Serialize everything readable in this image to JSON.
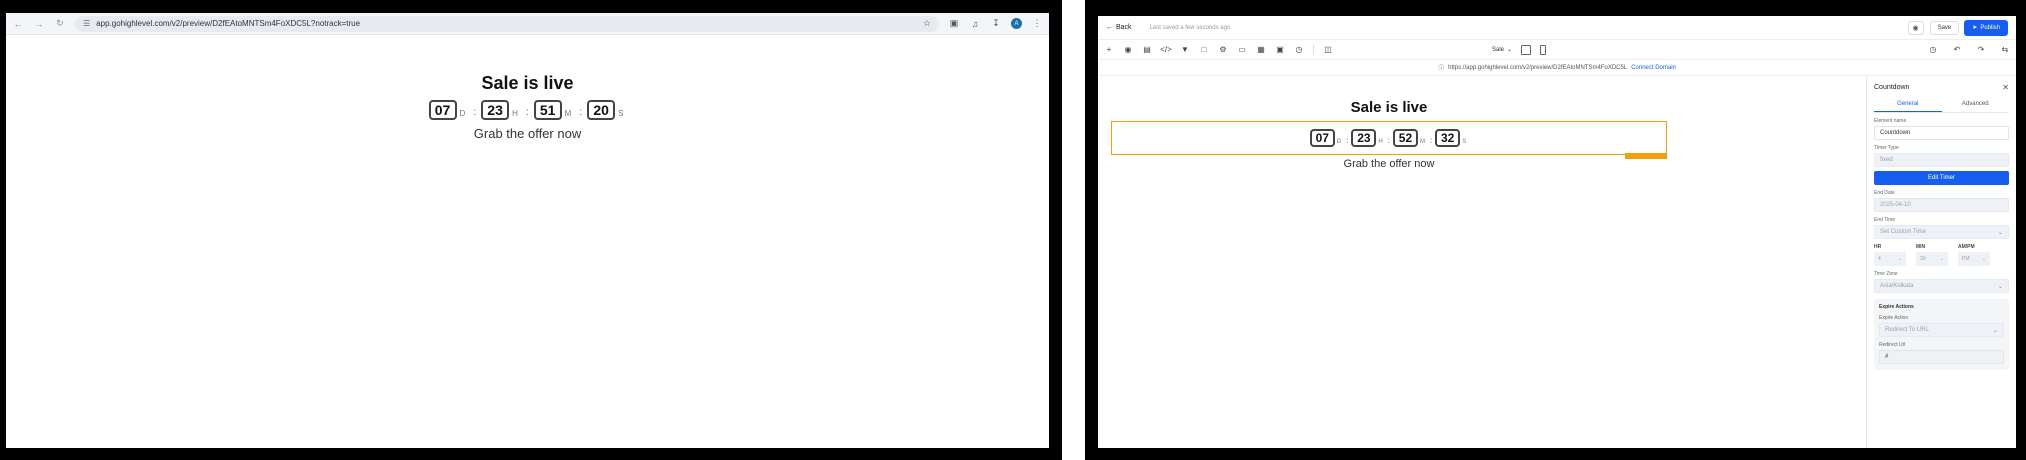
{
  "preview_browser": {
    "url": "app.gohighlevel.com/v2/preview/D2fEAtoMNTSm4FoXDC5L?notrack=true",
    "icons": [
      "back-arrow-icon",
      "forward-arrow-icon",
      "reload-icon",
      "site-settings-icon",
      "bookmark-star-icon",
      "extensions-icon",
      "media-controls-icon",
      "download-icon",
      "profile-avatar-icon",
      "more-menu-icon"
    ],
    "profile_initial": "A",
    "page": {
      "title": "Sale is live",
      "timer": {
        "days": "07",
        "days_unit": "D",
        "hours": "23",
        "hours_unit": "H",
        "minutes": "51",
        "minutes_unit": "M",
        "seconds": "20",
        "seconds_unit": "S",
        "separator": ":"
      },
      "subtitle": "Grab the offer now"
    }
  },
  "builder": {
    "header": {
      "back_label": "Back",
      "saved_text": "Last saved a few seconds ago",
      "save_label": "Save",
      "publish_label": "Publish"
    },
    "toolbar": {
      "page_select": "Sale"
    },
    "url_bar": {
      "url": "https://app.gohighlevel.com/v2/preview/D2fEAtoMNTSm4FoXDC5L",
      "connect_label": "Connect Domain"
    },
    "canvas": {
      "title": "Sale is live",
      "timer": {
        "days": "07",
        "days_unit": "D",
        "hours": "23",
        "hours_unit": "H",
        "minutes": "52",
        "minutes_unit": "M",
        "seconds": "32",
        "seconds_unit": "S",
        "separator": ":"
      },
      "subtitle": "Grab the offer now"
    },
    "side_panel": {
      "title": "Countdown",
      "tabs": [
        "General",
        "Advanced"
      ],
      "element_name_label": "Element name",
      "element_name_value": "Countdown",
      "timer_type_label": "Timer Type",
      "timer_type_value": "fixed",
      "edit_timer_label": "Edit Timer",
      "end_date_label": "End Date",
      "end_date_value": "2025-04-10",
      "end_time_label": "End Time",
      "end_time_value": "Set Custom Time",
      "hr_label": "HR",
      "hr_value": "4",
      "min_label": "MIN",
      "min_value": "30",
      "ampm_label": "AM/PM",
      "ampm_value": "PM",
      "time_zone_label": "Time Zone",
      "time_zone_value": "Asia/Kolkata",
      "expire_actions_title": "Expire Actions",
      "expire_action_label": "Expire Action",
      "expire_action_value": "Redirect To URL",
      "redirect_url_label": "Redirect Url",
      "redirect_url_value": "#"
    },
    "accent_color": "#155eef",
    "selection_color": "#f59e0b"
  }
}
